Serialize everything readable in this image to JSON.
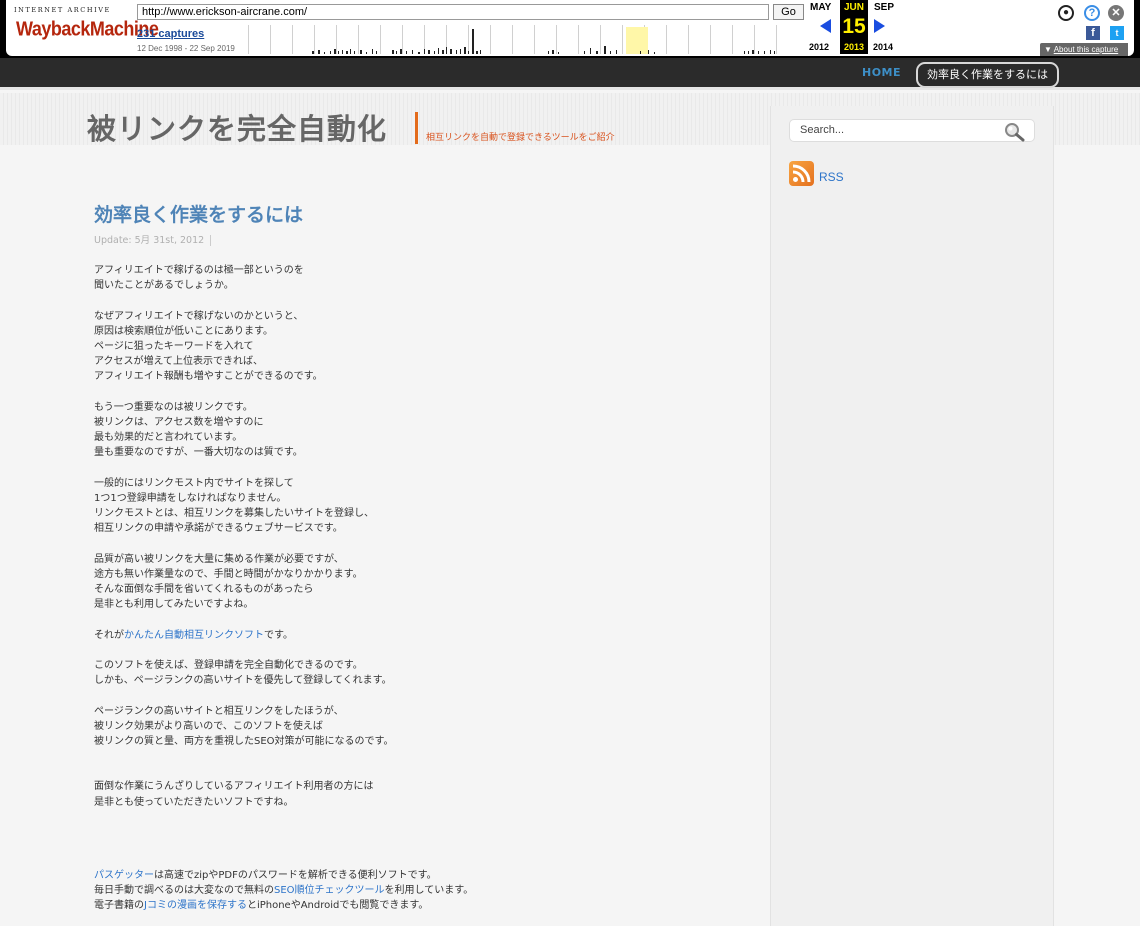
{
  "wayback": {
    "logo_top": "INTERNET ARCHIVE",
    "logo_main": "WaybackMachine",
    "url": "http://www.erickson-aircrane.com/",
    "go_label": "Go",
    "captures": "231 captures",
    "range": "12 Dec 1998 - 22 Sep 2019",
    "prev_month": "MAY",
    "current_month": "JUN",
    "next_month": "SEP",
    "day": "15",
    "prev_year": "2012",
    "current_year": "2013",
    "next_year": "2014",
    "about": "About this capture",
    "help_glyph": "?",
    "close_glyph": "✕",
    "facebook_glyph": "f",
    "twitter_glyph": "t",
    "user_glyph": "●",
    "accent": "#ffef00"
  },
  "nav": {
    "home": "HOME",
    "current": "効率良く作業をするには"
  },
  "header": {
    "title": "被リンクを完全自動化",
    "tagline": "相互リンクを自動で登録できるツールをご紹介"
  },
  "post": {
    "title": "効率良く作業をするには",
    "meta": "Update: 5月 31st, 2012",
    "p1": [
      "アフィリエイトで稼げるのは極一部というのを",
      "聞いたことがあるでしょうか。"
    ],
    "p2": [
      "なぜアフィリエイトで稼げないのかというと、",
      "原因は検索順位が低いことにあります。",
      "ページに狙ったキーワードを入れて",
      "アクセスが増えて上位表示できれば、",
      "アフィリエイト報酬も増やすことができるのです。"
    ],
    "p3": [
      "もう一つ重要なのは被リンクです。",
      "被リンクは、アクセス数を増やすのに",
      "最も効果的だと言われています。",
      "量も重要なのですが、一番大切なのは質です。"
    ],
    "p4": [
      "一般的にはリンクモスト内でサイトを探して",
      "1つ1つ登録申請をしなければなりません。",
      "リンクモストとは、相互リンクを募集したいサイトを登録し、",
      "相互リンクの申請や承諾ができるウェブサービスです。"
    ],
    "p5": [
      "品質が高い被リンクを大量に集める作業が必要ですが、",
      "途方も無い作業量なので、手間と時間がかなりかかります。",
      "そんな面倒な手間を省いてくれるものがあったら",
      "是非とも利用してみたいですよね。"
    ],
    "p6_pre": "それが",
    "p6_link": "かんたん自動相互リンクソフト",
    "p6_post": "です。",
    "p7": [
      "このソフトを使えば、登録申請を完全自動化できるのです。",
      "しかも、ページランクの高いサイトを優先して登録してくれます。"
    ],
    "p8": [
      "ページランクの高いサイトと相互リンクをしたほうが、",
      "被リンク効果がより高いので、このソフトを使えば",
      "被リンクの質と量、両方を重視したSEO対策が可能になるのです。"
    ],
    "p9": [
      "面倒な作業にうんざりしているアフィリエイト利用者の方には",
      "是非とも使っていただきたいソフトですね。"
    ]
  },
  "footer": {
    "l1_link": "パスゲッター",
    "l1_text": "は高速でzipやPDFのパスワードを解析できる便利ソフトです。",
    "l2_pre": "毎日手動で調べるのは大変なので無料の",
    "l2_link": "SEO順位チェックツール",
    "l2_post": "を利用しています。",
    "l3_pre": "電子書籍の",
    "l3_link": "Jコミの漫画を保存する",
    "l3_post": "とiPhoneやAndroidでも閲覧できます。"
  },
  "sidebar": {
    "search_placeholder": "Search...",
    "rss": "RSS"
  }
}
